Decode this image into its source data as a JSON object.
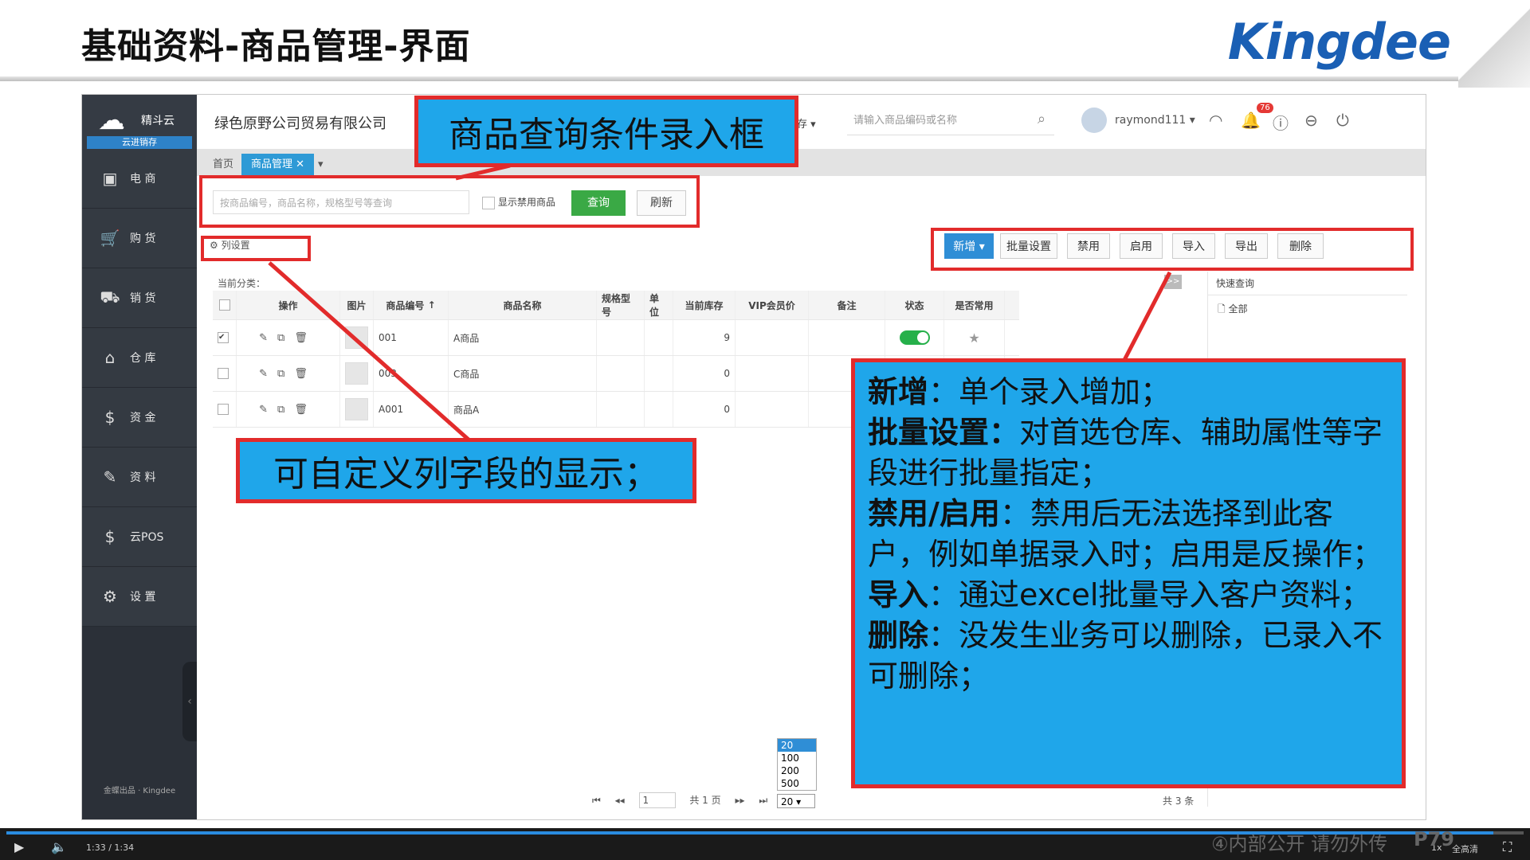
{
  "slide": {
    "title": "基础资料-商品管理-界面",
    "logo": "Kingdee"
  },
  "sidebar": {
    "brand": "精斗云",
    "sub": "云进销存",
    "items": [
      {
        "icon": "store-icon",
        "glyph": "▣",
        "label": "电 商"
      },
      {
        "icon": "cart-icon",
        "glyph": "🛒",
        "label": "购 货"
      },
      {
        "icon": "cart-out-icon",
        "glyph": "⛟",
        "label": "销 货"
      },
      {
        "icon": "warehouse-icon",
        "glyph": "⌂",
        "label": "仓 库"
      },
      {
        "icon": "money-icon",
        "glyph": "$",
        "label": "资 金"
      },
      {
        "icon": "pencil-icon",
        "glyph": "✎",
        "label": "资 料"
      },
      {
        "icon": "pos-icon",
        "glyph": "$",
        "label": "云POS"
      },
      {
        "icon": "gear-icon",
        "glyph": "⚙",
        "label": "设 置"
      }
    ],
    "footer": "金蝶出品 · Kingdee"
  },
  "topbar": {
    "company": "绿色原野公司贸易有限公司",
    "stock_dropdown": "库存",
    "search_placeholder": "请输入商品编码或名称",
    "user": "raymond111",
    "badge": "76"
  },
  "tabs": [
    {
      "label": "首页"
    },
    {
      "label": "商品管理"
    }
  ],
  "query": {
    "input_placeholder": "按商品编号，商品名称，规格型号等查询",
    "show_disabled": "显示禁用商品",
    "query_btn": "查询",
    "refresh_btn": "刷新"
  },
  "column_settings": "列设置",
  "toolbar": {
    "add": "新增",
    "batch": "批量设置",
    "disable": "禁用",
    "enable": "启用",
    "import": "导入",
    "export": "导出",
    "delete": "删除"
  },
  "category_label": "当前分类：",
  "grid": {
    "headers": {
      "op": "操作",
      "img": "图片",
      "code": "商品编号",
      "name": "商品名称",
      "spec": "规格型号",
      "unit": "单位",
      "stock": "当前库存",
      "vip": "VIP会员价",
      "remark": "备注",
      "status": "状态",
      "common": "是否常用"
    },
    "rows": [
      {
        "code": "001",
        "name": "A商品",
        "stock": "9",
        "checked": true,
        "status_on": true
      },
      {
        "code": "003",
        "name": "C商品",
        "stock": "0",
        "checked": false,
        "status_on": false
      },
      {
        "code": "A001",
        "name": "商品A",
        "stock": "0",
        "checked": false,
        "status_on": false
      }
    ]
  },
  "quick": {
    "title": "快速查询",
    "all": "全部"
  },
  "pager": {
    "page_input": "1",
    "total_pages": "共 1 页",
    "page_size": "20",
    "page_size_options": [
      "20",
      "100",
      "200",
      "500"
    ],
    "total": "共 3 条"
  },
  "annotations": {
    "query_box": "商品查询条件录入框",
    "column_custom": "可自定义列字段的显示；",
    "desc": [
      {
        "bold": "新增",
        "text": "：单个录入增加；"
      },
      {
        "bold": "批量设置：",
        "text": "对首选仓库、辅助属性等字段进行批量指定；"
      },
      {
        "bold": "禁用/启用",
        "text": "：禁用后无法选择到此客户，例如单据录入时；启用是反操作；"
      },
      {
        "bold": "导入",
        "text": "：通过excel批量导入客户资料；"
      },
      {
        "bold": "删除",
        "text": "：没发生业务可以删除，已录入不可删除；"
      }
    ]
  },
  "player": {
    "time": "1:33 / 1:34",
    "watermark": "④内部公开 请勿外传",
    "page": "P79",
    "speed": "1x",
    "quality": "全高清"
  }
}
